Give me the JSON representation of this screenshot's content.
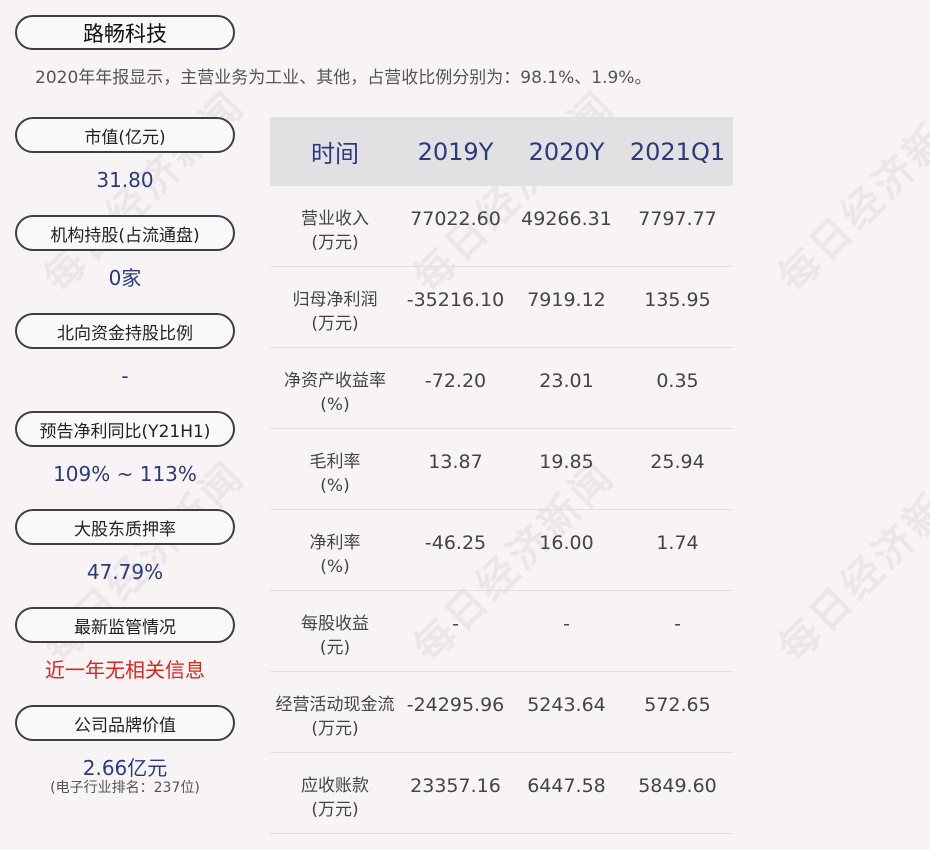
{
  "company": "路畅科技",
  "summary": "2020年年报显示，主营业务为工业、其他，占营收比例分别为：98.1%、1.9%。",
  "watermark": "每日经济新闻",
  "metrics": [
    {
      "label": "市值(亿元)",
      "value": "31.80"
    },
    {
      "label": "机构持股(占流通盘)",
      "value": "0家"
    },
    {
      "label": "北向资金持股比例",
      "value": "-"
    },
    {
      "label": "预告净利同比(Y21H1)",
      "value": "109% ~ 113%"
    },
    {
      "label": "大股东质押率",
      "value": "47.79%"
    },
    {
      "label": "最新监管情况",
      "value": "近一年无相关信息"
    },
    {
      "label": "公司品牌价值",
      "value": "2.66亿元",
      "sub": "(电子行业排名：237位)"
    }
  ],
  "table": {
    "headers": [
      "时间",
      "2019Y",
      "2020Y",
      "2021Q1"
    ],
    "rows": [
      {
        "label1": "营业收入",
        "label2": "(万元)",
        "v": [
          "77022.60",
          "49266.31",
          "7797.77"
        ]
      },
      {
        "label1": "归母净利润",
        "label2": "(万元)",
        "v": [
          "-35216.10",
          "7919.12",
          "135.95"
        ]
      },
      {
        "label1": "净资产收益率",
        "label2": "(%)",
        "v": [
          "-72.20",
          "23.01",
          "0.35"
        ]
      },
      {
        "label1": "毛利率",
        "label2": "(%)",
        "v": [
          "13.87",
          "19.85",
          "25.94"
        ]
      },
      {
        "label1": "净利率",
        "label2": "(%)",
        "v": [
          "-46.25",
          "16.00",
          "1.74"
        ]
      },
      {
        "label1": "每股收益",
        "label2": "(元)",
        "v": [
          "-",
          "-",
          "-"
        ]
      },
      {
        "label1": "经营活动现金流",
        "label2": "(万元)",
        "v": [
          "-24295.96",
          "5243.64",
          "572.65"
        ]
      },
      {
        "label1": "应收账款",
        "label2": "(万元)",
        "v": [
          "23357.16",
          "6447.58",
          "5849.60"
        ]
      }
    ]
  },
  "colors": {
    "accent": "#2b3a7c",
    "alert": "#d7261e",
    "header_bg": "#e3e0e4"
  }
}
